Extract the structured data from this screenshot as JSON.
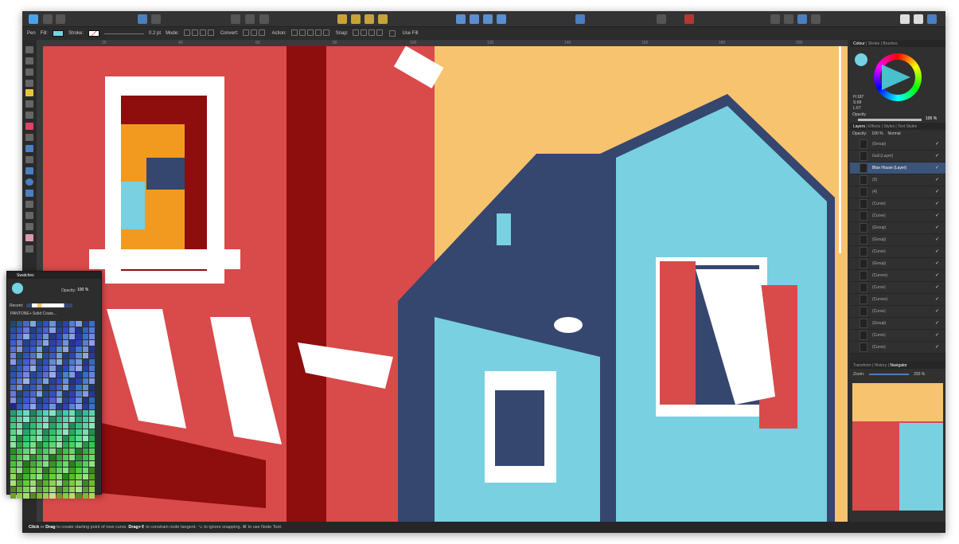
{
  "context_toolbar": {
    "tool": "Pen",
    "fill_label": "Fill:",
    "fill_color": "#74d3e3",
    "stroke_label": "Stroke:",
    "stroke_width": "0.2 pt",
    "mode_label": "Mode:",
    "convert_label": "Convert:",
    "action_label": "Action:",
    "snap_label": "Snap:",
    "use_fill_label": "Use Fill"
  },
  "ruler": [
    "20",
    "40",
    "60",
    "80",
    "100",
    "120",
    "140",
    "160",
    "180",
    "200"
  ],
  "colour_panel": {
    "tabs": [
      "Colour",
      "Stroke",
      "Brushes"
    ],
    "h": "H:187",
    "s": "S:68",
    "l": "L:67",
    "opacity_label": "Opacity",
    "opacity": "100 %"
  },
  "layers_panel": {
    "tabs": [
      "Layers",
      "Effects",
      "Styles",
      "Text Styles"
    ],
    "opacity_label": "Opacity:",
    "opacity": "100 %",
    "blend": "Normal",
    "items": [
      {
        "name": "(Group)"
      },
      {
        "name": "Gull (Layer)"
      },
      {
        "name": "Blue House (Layer)"
      },
      {
        "name": "(3)"
      },
      {
        "name": "(4)"
      },
      {
        "name": "(Curve)"
      },
      {
        "name": "(Curve)"
      },
      {
        "name": "(Group)"
      },
      {
        "name": "(Group)"
      },
      {
        "name": "(Curve)"
      },
      {
        "name": "(Group)"
      },
      {
        "name": "(Curves)"
      },
      {
        "name": "(Curve)"
      },
      {
        "name": "(Curves)"
      },
      {
        "name": "(Curve)"
      },
      {
        "name": "(Group)"
      },
      {
        "name": "(Curve)"
      },
      {
        "name": "(Curve)"
      }
    ]
  },
  "navigator_panel": {
    "tabs": [
      "Transform",
      "History",
      "Navigator"
    ],
    "zoom_label": "Zoom:",
    "zoom": "293 %"
  },
  "swatches_panel": {
    "title": "Swatches",
    "opacity_label": "Opacity:",
    "opacity": "100 %",
    "recent_label": "Recent:",
    "palette": "PANTONE+ Solid Coate..."
  },
  "status": {
    "click": "Click",
    "t1": " or ",
    "drag": "Drag",
    "t2": " to create starting point of new curve. ",
    "drag2": "Drag+⇧",
    "t3": " to constrain node tangent. ⌥ to ignore snapping. ⌘ to use Node Tool."
  },
  "colors": {
    "red": "#d94a4a",
    "dark_red": "#8e0d0d",
    "sky": "#f7c36f",
    "navy": "#35466f",
    "light_blue": "#78d0e0"
  }
}
